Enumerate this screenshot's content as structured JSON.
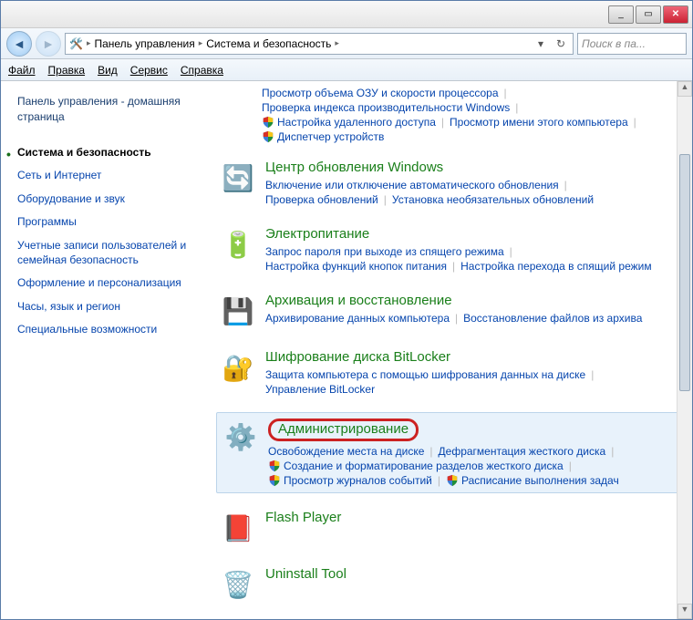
{
  "titlebar": {
    "min": "_",
    "max": "▭",
    "close": "✕"
  },
  "nav": {
    "back": "◄",
    "fwd": "►",
    "crumbs": [
      "Панель управления",
      "Система и безопасность"
    ],
    "dropdown": "▾",
    "refresh": "↻",
    "search_placeholder": "Поиск в па..."
  },
  "menu": [
    "Файл",
    "Правка",
    "Вид",
    "Сервис",
    "Справка"
  ],
  "sidebar": {
    "home": "Панель управления - домашняя страница",
    "items": [
      {
        "label": "Система и безопасность",
        "current": true
      },
      {
        "label": "Сеть и Интернет"
      },
      {
        "label": "Оборудование и звук"
      },
      {
        "label": "Программы"
      },
      {
        "label": "Учетные записи пользователей и семейная безопасность"
      },
      {
        "label": "Оформление и персонализация"
      },
      {
        "label": "Часы, язык и регион"
      },
      {
        "label": "Специальные возможности"
      }
    ]
  },
  "toplinks": [
    {
      "label": "Просмотр объема ОЗУ и скорости процессора"
    },
    {
      "label": "Проверка индекса производительности Windows"
    },
    {
      "label": "Настройка удаленного доступа",
      "shield": true
    },
    {
      "label": "Просмотр имени этого компьютера"
    },
    {
      "label": "Диспетчер устройств",
      "shield": true
    }
  ],
  "sections": [
    {
      "icon": "🔄",
      "title": "Центр обновления Windows",
      "links": [
        {
          "label": "Включение или отключение автоматического обновления"
        },
        {
          "label": "Проверка обновлений"
        },
        {
          "label": "Установка необязательных обновлений"
        }
      ]
    },
    {
      "icon": "🔋",
      "title": "Электропитание",
      "links": [
        {
          "label": "Запрос пароля при выходе из спящего режима"
        },
        {
          "label": "Настройка функций кнопок питания"
        },
        {
          "label": "Настройка перехода в спящий режим"
        }
      ]
    },
    {
      "icon": "💾",
      "title": "Архивация и восстановление",
      "links": [
        {
          "label": "Архивирование данных компьютера"
        },
        {
          "label": "Восстановление файлов из архива"
        }
      ]
    },
    {
      "icon": "🔐",
      "title": "Шифрование диска BitLocker",
      "links": [
        {
          "label": "Защита компьютера с помощью шифрования данных на диске"
        },
        {
          "label": "Управление BitLocker"
        }
      ]
    },
    {
      "icon": "⚙️",
      "title": "Администрирование",
      "highlight": true,
      "ringed": true,
      "links": [
        {
          "label": "Освобождение места на диске"
        },
        {
          "label": "Дефрагментация жесткого диска"
        },
        {
          "label": "Создание и форматирование разделов жесткого диска",
          "shield": true
        },
        {
          "label": "Просмотр журналов событий",
          "shield": true
        },
        {
          "label": "Расписание выполнения задач",
          "shield": true
        }
      ]
    },
    {
      "icon": "📕",
      "title": "Flash Player",
      "links": []
    },
    {
      "icon": "🗑️",
      "title": "Uninstall Tool",
      "links": []
    }
  ]
}
